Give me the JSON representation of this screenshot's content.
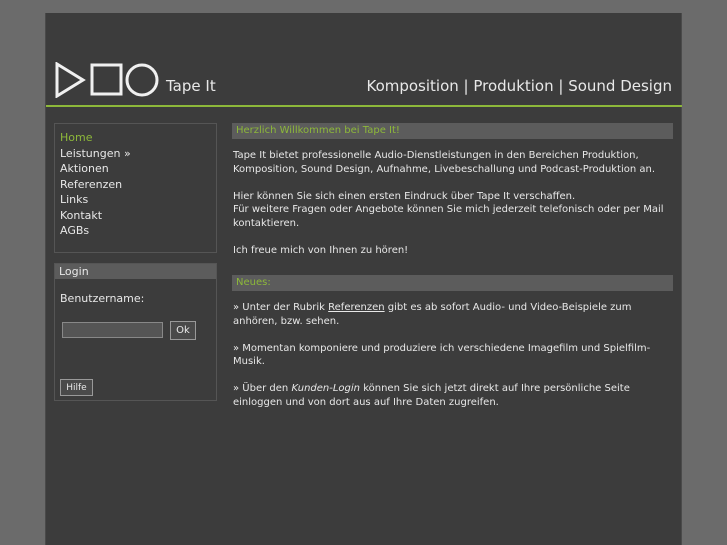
{
  "header": {
    "brand": "Tape It",
    "slogan": "Komposition | Produktion | Sound Design",
    "logo_icon": "play-square-circle-logo",
    "accent_color": "#8db83a"
  },
  "nav": {
    "items": [
      {
        "label": "Home",
        "active": true
      },
      {
        "label": "Leistungen »"
      },
      {
        "label": "Aktionen"
      },
      {
        "label": "Referenzen"
      },
      {
        "label": "Links"
      },
      {
        "label": "Kontakt"
      },
      {
        "label": "AGBs"
      }
    ]
  },
  "login": {
    "title": "Login",
    "username_label": "Benutzername:",
    "username_value": "",
    "ok_label": "Ok",
    "help_label": "Hilfe"
  },
  "welcome": {
    "title": "Herzlich Willkommen bei Tape It!",
    "p1": "Tape It bietet professionelle Audio-Dienstleistungen in den Bereichen Produktion, Komposition, Sound Design, Aufnahme, Livebeschallung und Podcast-Produktion an.",
    "p2_line1": "Hier können Sie sich einen ersten Eindruck über Tape It verschaffen.",
    "p2_line2": "Für weitere Fragen oder Angebote können Sie mich jederzeit telefonisch oder per Mail kontaktieren.",
    "p3": "Ich freue mich von Ihnen zu hören!"
  },
  "news": {
    "title": "Neues:",
    "item1_pre": "» Unter der Rubrik ",
    "item1_link": "Referenzen",
    "item1_post": " gibt es ab sofort Audio- und Video-Beispiele zum anhören, bzw. sehen.",
    "item2": "» Momentan komponiere und produziere ich verschiedene Imagefilm und Spielfilm-Musik.",
    "item3_pre": "» Über den ",
    "item3_em": "Kunden-Login",
    "item3_post": " können Sie sich jetzt direkt auf Ihre persönliche Seite einloggen und von dort aus auf Ihre Daten zugreifen."
  }
}
